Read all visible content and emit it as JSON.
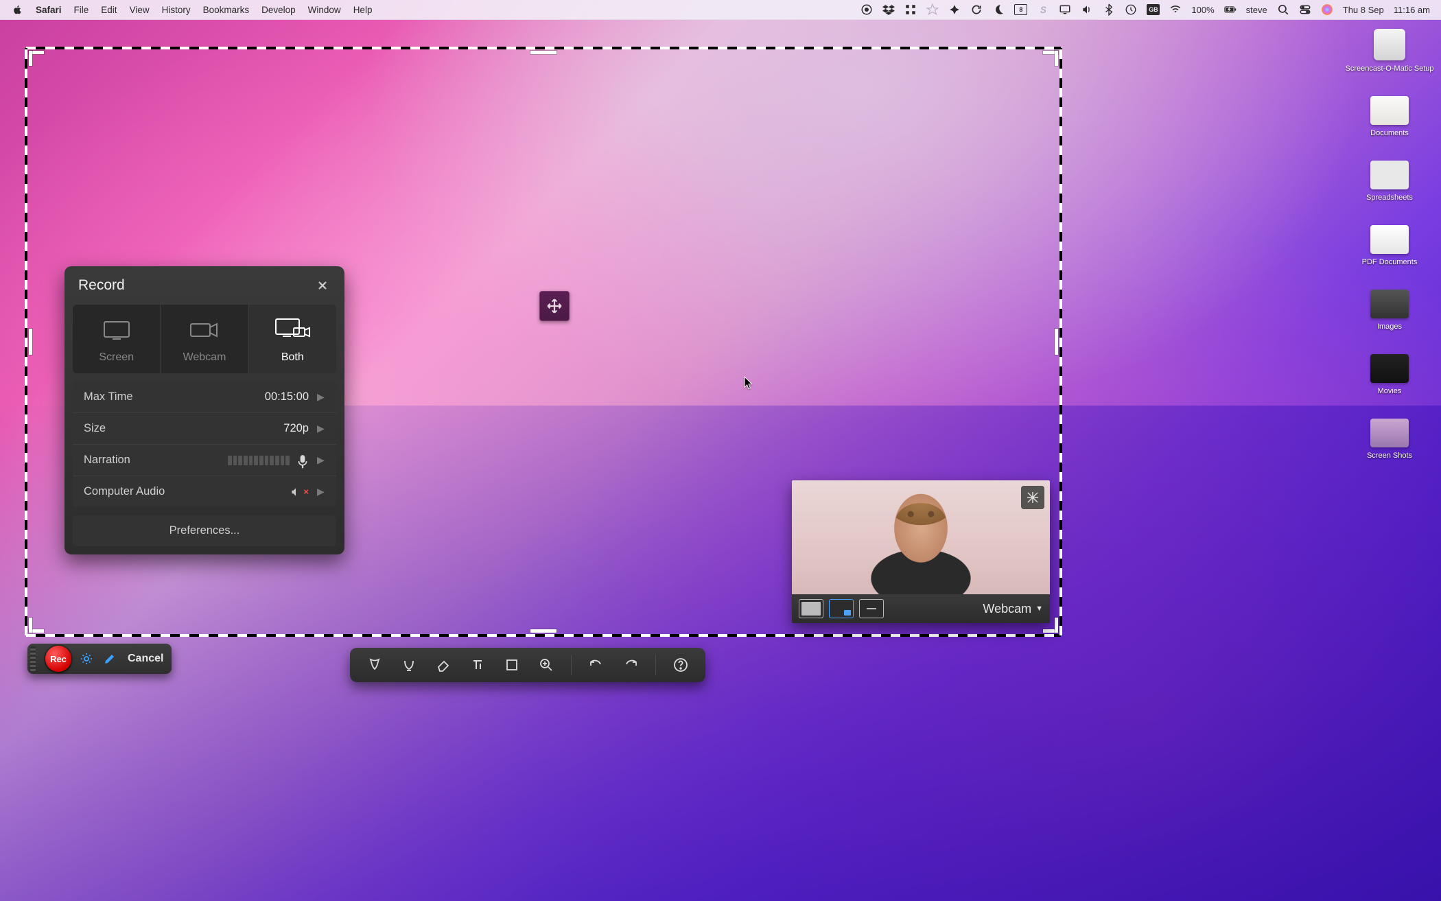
{
  "menubar": {
    "app_name": "Safari",
    "items": [
      "File",
      "Edit",
      "View",
      "History",
      "Bookmarks",
      "Develop",
      "Window",
      "Help"
    ],
    "battery_pct": "100%",
    "keyboard_lang": "GB",
    "calendar_day": "8",
    "user": "steve",
    "date": "Thu 8 Sep",
    "time": "11:16 am"
  },
  "desktop_icons": {
    "items": [
      "Screencast-O-Matic Setup",
      "Documents",
      "Spreadsheets",
      "PDF Documents",
      "Images",
      "Movies",
      "Screen Shots"
    ]
  },
  "record_panel": {
    "title": "Record",
    "modes": {
      "screen": "Screen",
      "webcam": "Webcam",
      "both": "Both",
      "active": "both"
    },
    "settings": {
      "max_time_label": "Max Time",
      "max_time_value": "00:15:00",
      "size_label": "Size",
      "size_value": "720p",
      "narration_label": "Narration",
      "computer_audio_label": "Computer Audio"
    },
    "preferences_label": "Preferences..."
  },
  "control_bar": {
    "rec_label": "Rec",
    "cancel_label": "Cancel"
  },
  "webcam_panel": {
    "label": "Webcam"
  }
}
